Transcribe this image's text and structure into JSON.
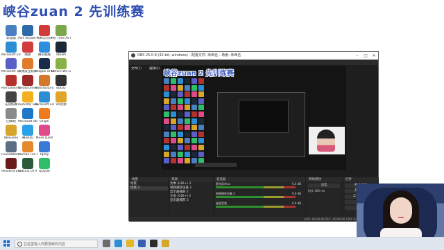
{
  "overlay_title": "峡谷zuan 2 先训练赛",
  "desktop": {
    "icons": [
      {
        "label": "此电脑",
        "color": "#4a7fc1"
      },
      {
        "label": "Microsoft Edge",
        "color": "#2c8fd6"
      },
      {
        "label": "Microsoft Teams",
        "color": "#5a5fc8"
      },
      {
        "label": "Red Dead Redempt...",
        "color": "#b3322b"
      },
      {
        "label": "先训练赛",
        "color": "#444"
      },
      {
        "label": "回收站",
        "color": "#8a8a8a"
      },
      {
        "label": "WeGame",
        "color": "#d6a62a"
      },
      {
        "label": "Foundation Soundtrack",
        "color": "#5c6d86"
      },
      {
        "label": "Resident Evil Village",
        "color": "#6b1a1a"
      },
      {
        "label": "Port Royale 4",
        "color": "#2d6ca9"
      },
      {
        "label": "网易",
        "color": "#d23c3c"
      },
      {
        "label": "火绒安全软件",
        "color": "#e07a2c"
      },
      {
        "label": "Ghostrunner",
        "color": "#9c2a2a"
      },
      {
        "label": "Rockstar Games",
        "color": "#f2b01e"
      },
      {
        "label": "Microsoft Store",
        "color": "#1e78c8"
      },
      {
        "label": "腾讯QQ",
        "color": "#2aa0e6"
      },
      {
        "label": "Human Fall Flat",
        "color": "#e48a2c"
      },
      {
        "label": "Sakuna Of Rice and...",
        "color": "#2b5c3a"
      },
      {
        "label": "网易云音乐",
        "color": "#d33a3a"
      },
      {
        "label": "腾讯视频",
        "color": "#2c8fe0"
      },
      {
        "label": "League of Legends",
        "color": "#1a2a4a"
      },
      {
        "label": "Satisfactory",
        "color": "#d6782a"
      },
      {
        "label": "Microsoft Edge",
        "color": "#2c8fd6"
      },
      {
        "label": "Origin",
        "color": "#f07a1e"
      },
      {
        "label": "Muse Dash",
        "color": "#e04a8a"
      },
      {
        "label": "Uplay",
        "color": "#3a7ad6"
      },
      {
        "label": "QQ音乐",
        "color": "#2fbf6a"
      },
      {
        "label": "My Time At Portia",
        "color": "#7aa84a"
      },
      {
        "label": "Steam",
        "color": "#1b2838"
      },
      {
        "label": "Before We Leave",
        "color": "#8ab04a"
      },
      {
        "label": "obs32",
        "color": "#333333"
      },
      {
        "label": "VR资源",
        "color": "#e0a62a"
      }
    ]
  },
  "obs": {
    "title": "OBS 25.0.8 (32-bit, windows) - 配置文件: 未命名 - 场景: 未命名",
    "menu": [
      "文件(F)",
      "编辑(E)",
      "视图(V)",
      "配置文件(P)",
      "场景集合(S)",
      "工具(T)",
      "帮助(H)"
    ],
    "canvas_title": "峡谷zuan 2 先训练赛",
    "docks": {
      "scenes_title": "场景",
      "sources_title": "来源",
      "mixer_title": "混音器",
      "transitions_title": "转场特效",
      "controls_title": "控件"
    },
    "scenes": [
      "场景",
      "场景 2"
    ],
    "sources": [
      "文本 (GDI+) 3",
      "视频捕获设备 2",
      "显示器捕获 2",
      "文本 (GDI+) 2",
      "显示器捕获 3"
    ],
    "mixer": [
      {
        "name": "麦克风/Aux",
        "db": "-5.4 dB"
      },
      {
        "name": "视频捕获设备 2",
        "db": "0.0 dB"
      },
      {
        "name": "桌面音频",
        "db": "0.0 dB"
      }
    ],
    "controls": [
      "开始推流",
      "开始录制",
      "工作室模式",
      "设置",
      "退出"
    ],
    "transition": {
      "type": "淡出",
      "duration_label": "时长",
      "duration": "300 ms"
    },
    "status": "LIVE: 00:00:00   REC: 00:00:00   CPU: 9.0%, 30.00 fps"
  },
  "taskbar": {
    "search_placeholder": "在这里输入你要搜索的内容"
  }
}
